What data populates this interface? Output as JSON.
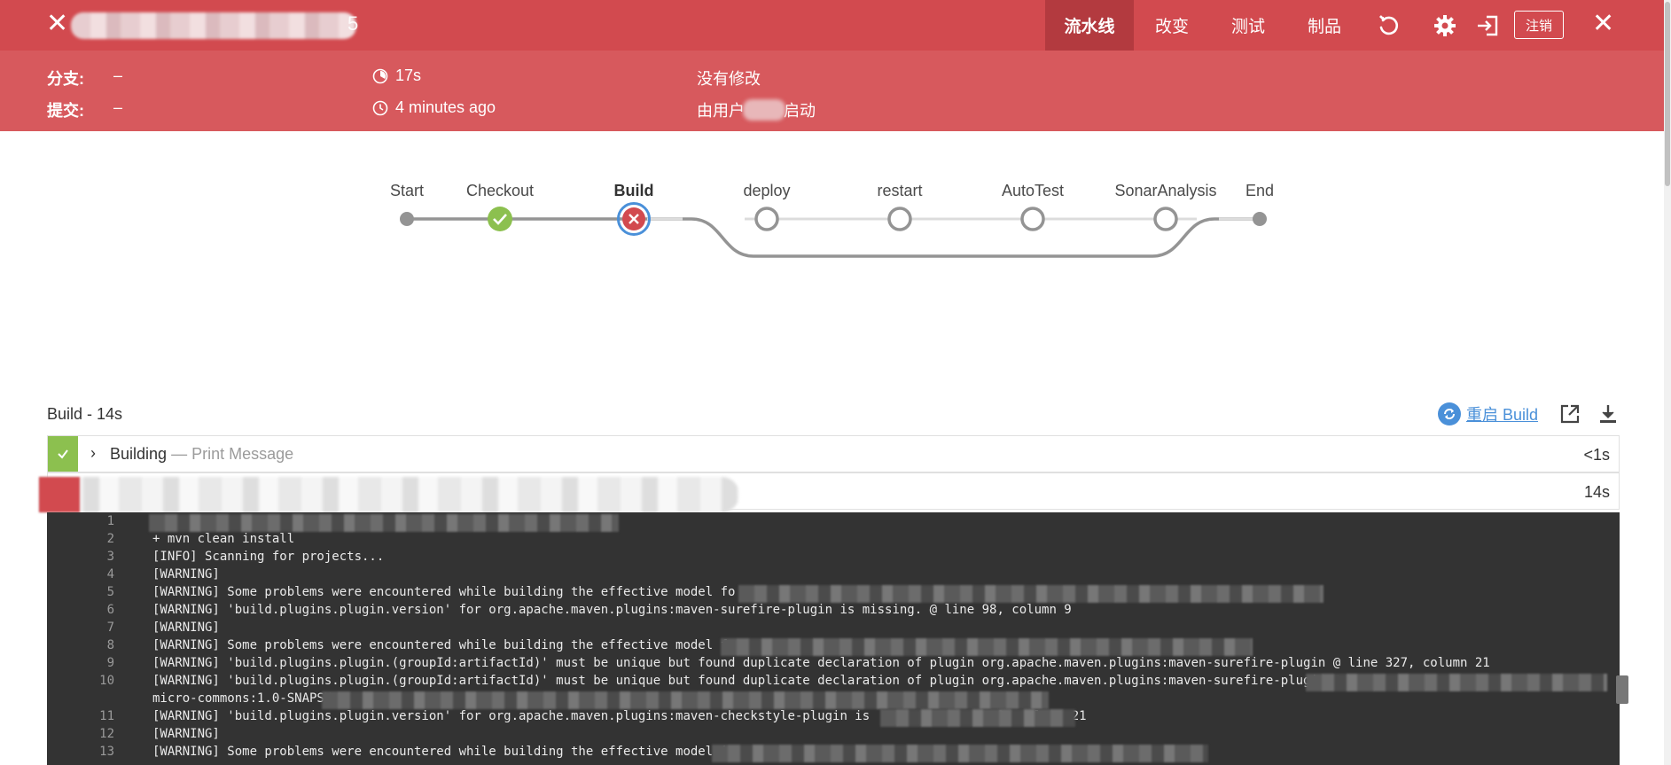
{
  "header": {
    "title_suffix": "5",
    "nav": [
      {
        "label": "流水线",
        "active": true
      },
      {
        "label": "改变",
        "active": false
      },
      {
        "label": "测试",
        "active": false
      },
      {
        "label": "制品",
        "active": false
      }
    ],
    "icons": [
      "replay-icon",
      "gear-icon",
      "exit-icon"
    ],
    "logout_label": "注销",
    "close_icon": "close-icon",
    "colors": {
      "bar": "#d24a4f",
      "info_bar": "#d7595d",
      "active_tab": "#b33a3f"
    }
  },
  "info": {
    "branch_label": "分支:",
    "branch_value": "–",
    "commit_label": "提交:",
    "commit_value": "–",
    "duration": "17s",
    "time_ago": "4 minutes ago",
    "changes": "没有修改",
    "started_by_prefix": "由用户",
    "started_by_suffix": "启动"
  },
  "pipeline": {
    "stages": [
      {
        "name": "Start",
        "status": "terminal"
      },
      {
        "name": "Checkout",
        "status": "success"
      },
      {
        "name": "Build",
        "status": "failed",
        "current": true
      },
      {
        "name": "deploy",
        "status": "not-built"
      },
      {
        "name": "restart",
        "status": "not-built"
      },
      {
        "name": "AutoTest",
        "status": "not-built"
      },
      {
        "name": "SonarAnalysis",
        "status": "not-built"
      },
      {
        "name": "End",
        "status": "terminal"
      }
    ],
    "colors": {
      "success": "#8cc04f",
      "failed": "#d24a4f",
      "current_ring": "#4a90d9",
      "line": "#949494"
    }
  },
  "build": {
    "title": "Build - 14s",
    "restart_label": "重启 Build",
    "steps": [
      {
        "name": "Building",
        "sub": "— Print Message",
        "duration": "<1s",
        "status": "success"
      },
      {
        "name": "",
        "sub": "",
        "duration": "14s",
        "status": "failed"
      }
    ]
  },
  "log": {
    "lines": [
      {
        "n": "1",
        "text": ""
      },
      {
        "n": "2",
        "text": "+ mvn clean install"
      },
      {
        "n": "3",
        "text": "[INFO] Scanning for projects..."
      },
      {
        "n": "4",
        "text": "[WARNING]"
      },
      {
        "n": "5",
        "text": "[WARNING] Some problems were encountered while building the effective model fo"
      },
      {
        "n": "6",
        "text": "[WARNING] 'build.plugins.plugin.version' for org.apache.maven.plugins:maven-surefire-plugin is missing. @ line 98, column 9"
      },
      {
        "n": "7",
        "text": "[WARNING]"
      },
      {
        "n": "8",
        "text": "[WARNING] Some problems were encountered while building the effective model f"
      },
      {
        "n": "9",
        "text": "[WARNING] 'build.plugins.plugin.(groupId:artifactId)' must be unique but found duplicate declaration of plugin org.apache.maven.plugins:maven-surefire-plugin @ line 327, column 21"
      },
      {
        "n": "10",
        "text": "[WARNING] 'build.plugins.plugin.(groupId:artifactId)' must be unique but found duplicate declaration of plugin org.apache.maven.plugins:maven-surefire-plugin @"
      },
      {
        "n": "",
        "text": "micro-commons:1.0-SNAPSH"
      },
      {
        "n": "11",
        "text": "[WARNING] 'build.plugins.plugin.version' for org.apache.maven.plugins:maven-checkstyle-plugin is                 8, column 21"
      },
      {
        "n": "12",
        "text": "[WARNING]"
      },
      {
        "n": "13",
        "text": "[WARNING] Some problems were encountered while building the effective model i"
      }
    ]
  }
}
